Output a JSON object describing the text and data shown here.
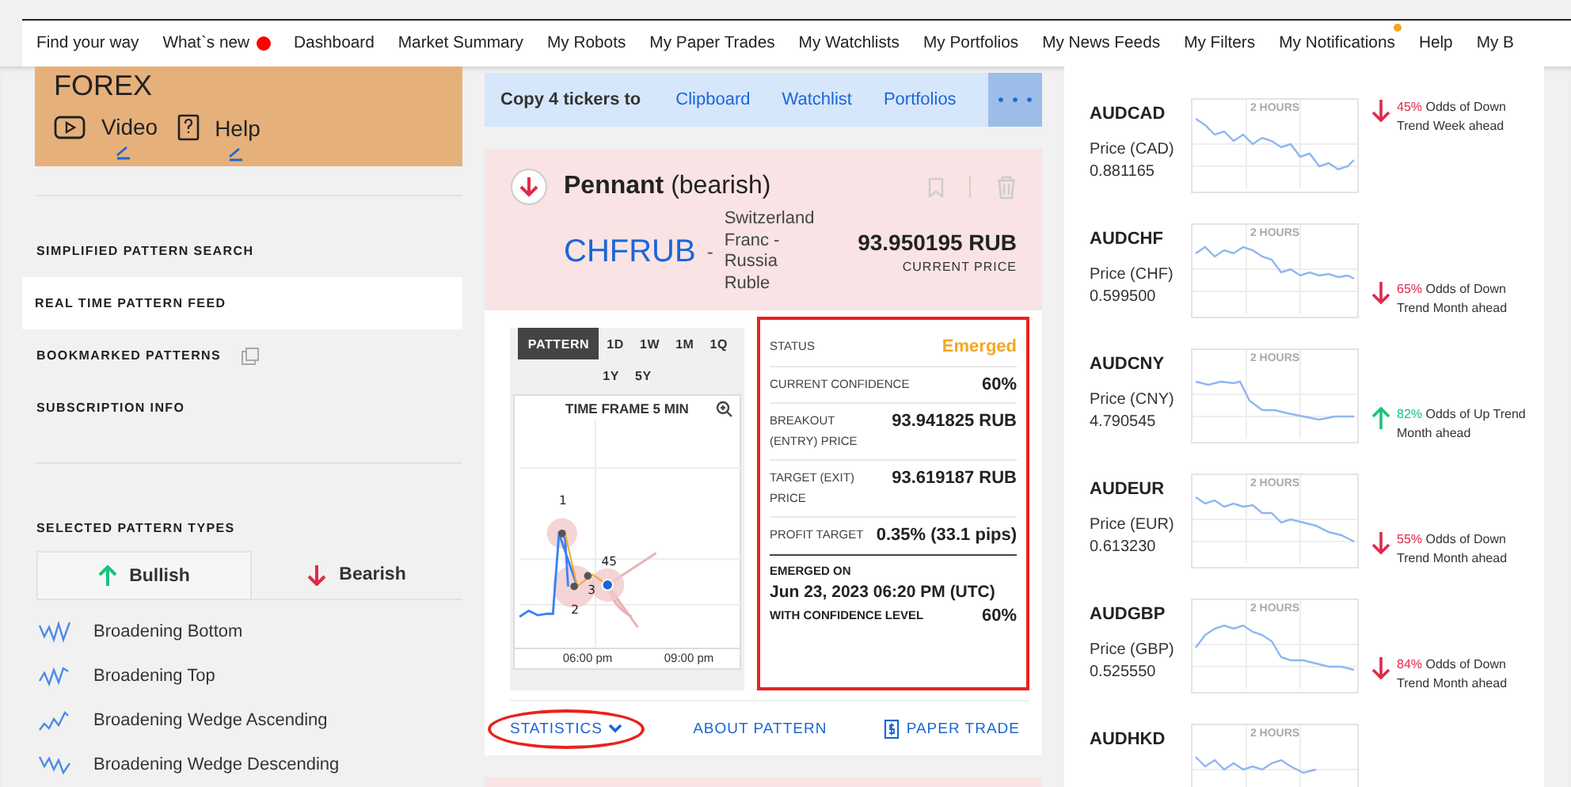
{
  "nav": {
    "items": [
      {
        "label": "Find your way"
      },
      {
        "label": "What`s new",
        "color": "#ff0000"
      },
      {
        "label": "Dashboard"
      },
      {
        "label": "Market Summary"
      },
      {
        "label": "My Robots"
      },
      {
        "label": "My Paper Trades"
      },
      {
        "label": "My Watchlists"
      },
      {
        "label": "My Portfolios"
      },
      {
        "label": "My News Feeds"
      },
      {
        "label": "My Filters"
      },
      {
        "label": "My Notifications",
        "color": "#f5a623"
      },
      {
        "label": "Help"
      },
      {
        "label": "My B"
      }
    ]
  },
  "sidebar": {
    "market_card": {
      "title": "FOREX",
      "links": [
        {
          "kind": "video",
          "label": "Video"
        },
        {
          "kind": "help",
          "label": "Help"
        }
      ]
    },
    "menu": [
      {
        "label": "SIMPLIFIED PATTERN SEARCH",
        "selected": false,
        "external": false
      },
      {
        "label": "REAL TIME PATTERN FEED",
        "selected": true,
        "external": false
      },
      {
        "label": "BOOKMARKED PATTERNS",
        "selected": false,
        "external": true
      },
      {
        "label": "SUBSCRIPTION INFO",
        "selected": false,
        "external": false
      }
    ],
    "pattern_types": {
      "heading": "SELECTED PATTERN TYPES",
      "tabs": [
        {
          "label": "Bullish",
          "kind": "up",
          "selected": true
        },
        {
          "label": "Bearish",
          "kind": "down",
          "selected": false
        }
      ],
      "items": [
        {
          "label": "Broadening Bottom",
          "kind": "bottom"
        },
        {
          "label": "Broadening Top",
          "kind": "top"
        },
        {
          "label": "Broadening Wedge Ascending",
          "kind": "ascending"
        },
        {
          "label": "Broadening Wedge Descending",
          "kind": "descending"
        }
      ]
    }
  },
  "copy_bar": {
    "label": "Copy 4 tickers to",
    "links": [
      "Clipboard",
      "Watchlist",
      "Portfolios"
    ]
  },
  "pattern": {
    "kind": "bearish",
    "name": "Pennant",
    "qualifier": "(bearish)",
    "symbol": "CHFRUB",
    "separator": "-",
    "description": "Switzerland Franc - Russia Ruble",
    "price": "93.950195 RUB",
    "price_label": "CURRENT PRICE",
    "bookmarked": false,
    "timeframes": [
      {
        "label": "PATTERN",
        "selected": true
      },
      {
        "label": "1D",
        "selected": false
      },
      {
        "label": "1W",
        "selected": false
      },
      {
        "label": "1M",
        "selected": false
      },
      {
        "label": "1Q",
        "selected": false
      },
      {
        "label": "1Y",
        "selected": false
      },
      {
        "label": "5Y",
        "selected": false
      }
    ],
    "chart": {
      "title": "TIME FRAME 5 MIN",
      "point_labels": [
        "1",
        "2",
        "3",
        "4",
        "5"
      ],
      "x_labels": [
        "06:00 pm",
        "09:00 pm"
      ]
    },
    "stats": {
      "highlighted": true,
      "rows": [
        {
          "label": "STATUS",
          "value": "Emerged",
          "kind": "status"
        },
        {
          "label": "CURRENT CONFIDENCE",
          "value": "60%",
          "kind": "plain"
        },
        {
          "label": "BREAKOUT (ENTRY) PRICE",
          "value": "93.941825 RUB",
          "kind": "plain"
        },
        {
          "label": "TARGET (EXIT) PRICE",
          "value": "93.619187 RUB",
          "kind": "plain"
        },
        {
          "label": "PROFIT TARGET",
          "value": "0.35% (33.1 pips)",
          "kind": "plain"
        }
      ],
      "emerged_label": "EMERGED ON",
      "emerged_date": "Jun 23, 2023 06:20 PM (UTC)",
      "confidence_label": "WITH CONFIDENCE LEVEL",
      "confidence_value": "60%"
    },
    "links": [
      {
        "label": "STATISTICS",
        "kind": "dropdown",
        "highlighted": true
      },
      {
        "label": "ABOUT PATTERN",
        "kind": "plain",
        "highlighted": false
      },
      {
        "label": "PAPER TRADE",
        "kind": "paper",
        "highlighted": false
      }
    ]
  },
  "watchlist": [
    {
      "symbol": "AUDCAD",
      "price_label": "Price (CAD)",
      "price": "0.881165",
      "chart_label": "2 HOURS",
      "kind": "down",
      "odds": "45%",
      "odds_text": "Odds of Down Trend Week ahead"
    },
    {
      "symbol": "AUDCHF",
      "price_label": "Price (CHF)",
      "price": "0.599500",
      "chart_label": "2 HOURS",
      "kind": "down",
      "odds": "65%",
      "odds_text": "Odds of Down Trend Month ahead"
    },
    {
      "symbol": "AUDCNY",
      "price_label": "Price (CNY)",
      "price": "4.790545",
      "chart_label": "2 HOURS",
      "kind": "up",
      "odds": "82%",
      "odds_text": "Odds of Up Trend Month ahead"
    },
    {
      "symbol": "AUDEUR",
      "price_label": "Price (EUR)",
      "price": "0.613230",
      "chart_label": "2 HOURS",
      "kind": "down",
      "odds": "55%",
      "odds_text": "Odds of Down Trend Month ahead"
    },
    {
      "symbol": "AUDGBP",
      "price_label": "Price (GBP)",
      "price": "0.525550",
      "chart_label": "2 HOURS",
      "kind": "down",
      "odds": "84%",
      "odds_text": "Odds of Down Trend Month ahead"
    },
    {
      "symbol": "AUDHKD",
      "chart_label": "2 HOURS"
    }
  ]
}
